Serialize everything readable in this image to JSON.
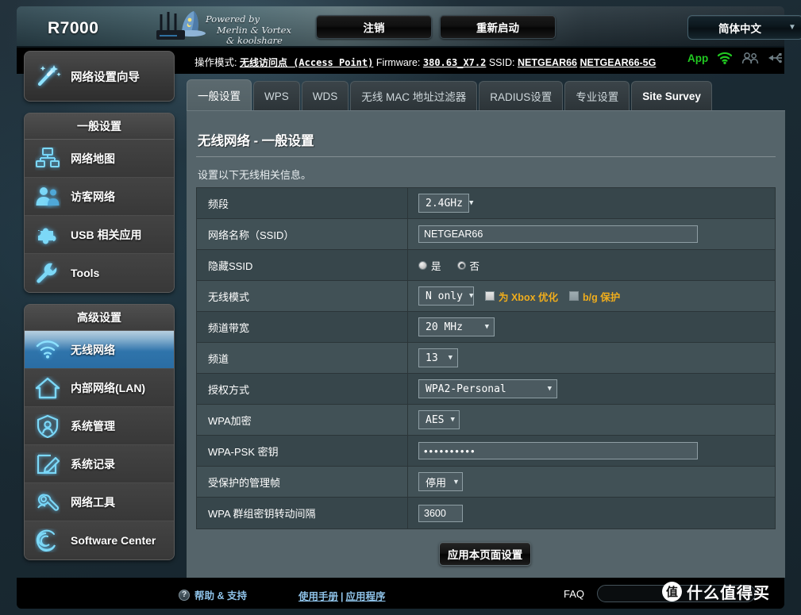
{
  "header": {
    "model": "R7000",
    "powered_line1": "Powered by",
    "powered_line2": "Merlin & Vortex",
    "powered_line3": "& koolshare",
    "logout_label": "注销",
    "reboot_label": "重新启动",
    "language": "简体中文",
    "language_arrow": "▼"
  },
  "status": {
    "mode_label": "操作模式:",
    "mode_value": "无线访问点 (Access Point)",
    "firmware_label": "Firmware:",
    "firmware_value": "380.63_X7.2",
    "ssid_label": "SSID:",
    "ssid_1": "NETGEAR66",
    "ssid_2": "NETGEAR66-5G",
    "app_label": "App",
    "icons": [
      "wifi-icon",
      "users-icon",
      "usb-icon"
    ]
  },
  "sidebar": {
    "wizard": {
      "label": "网络设置向导",
      "icon": "magic-wand-icon"
    },
    "group_general": {
      "title": "一般设置",
      "items": [
        {
          "label": "网络地图",
          "icon": "network-map-icon"
        },
        {
          "label": "访客网络",
          "icon": "guest-users-icon"
        },
        {
          "label": "USB 相关应用",
          "icon": "puzzle-icon"
        },
        {
          "label": "Tools",
          "icon": "wrench-icon"
        }
      ]
    },
    "group_advanced": {
      "title": "高级设置",
      "items": [
        {
          "label": "无线网络",
          "icon": "wifi-icon",
          "active": true
        },
        {
          "label": "内部网络(LAN)",
          "icon": "home-icon",
          "active": false
        },
        {
          "label": "系统管理",
          "icon": "user-admin-icon",
          "active": false
        },
        {
          "label": "系统记录",
          "icon": "edit-note-icon",
          "active": false
        },
        {
          "label": "网络工具",
          "icon": "network-tools-icon",
          "active": false
        },
        {
          "label": "Software Center",
          "icon": "debian-swirl-icon",
          "active": false
        }
      ]
    }
  },
  "tabs": [
    {
      "label": "一般设置",
      "active": true
    },
    {
      "label": "WPS",
      "active": false
    },
    {
      "label": "WDS",
      "active": false
    },
    {
      "label": "无线 MAC 地址过滤器",
      "active": false
    },
    {
      "label": "RADIUS设置",
      "active": false
    },
    {
      "label": "专业设置",
      "active": false
    },
    {
      "label": "Site Survey",
      "active": false
    }
  ],
  "panel": {
    "title": "无线网络 - 一般设置",
    "description": "设置以下无线相关信息。",
    "apply_label": "应用本页面设置"
  },
  "form": [
    {
      "label": "频段",
      "type": "select",
      "value": "2.4GHz"
    },
    {
      "label": "网络名称（SSID）",
      "type": "text",
      "value": "NETGEAR66"
    },
    {
      "label": "隐藏SSID",
      "type": "radio",
      "options": [
        {
          "label": "是",
          "selected": false
        },
        {
          "label": "否",
          "selected": true
        }
      ]
    },
    {
      "label": "无线模式",
      "type": "select-checkbox",
      "value": "N only",
      "checkboxes": [
        {
          "label": "为 Xbox 优化",
          "checked": false
        },
        {
          "label": "b/g 保护",
          "checked": false
        }
      ]
    },
    {
      "label": "频道带宽",
      "type": "select",
      "value": "20 MHz"
    },
    {
      "label": "频道",
      "type": "select",
      "value": "13"
    },
    {
      "label": "授权方式",
      "type": "select",
      "value": "WPA2-Personal"
    },
    {
      "label": "WPA加密",
      "type": "select",
      "value": "AES"
    },
    {
      "label": "WPA-PSK 密钥",
      "type": "password",
      "value": "••••••••••"
    },
    {
      "label": "受保护的管理帧",
      "type": "select",
      "value": "停用"
    },
    {
      "label": "WPA 群组密钥转动间隔",
      "type": "text",
      "value": "3600"
    }
  ],
  "footer": {
    "help_label": "帮助 & 支持",
    "help_icon": "question-icon",
    "manual_link": "使用手册",
    "link_separator": "|",
    "apps_link": "应用程序",
    "faq_label": "FAQ",
    "search_placeholder": ""
  },
  "watermark": {
    "badge": "值",
    "text": "什么值得买"
  },
  "colors": {
    "accent_blue": "#2f74ab",
    "link_blue": "#8ec2e8",
    "checkbox_label": "#f0ad1c",
    "panel_bg": "#55646a",
    "row_odd": "#37464b",
    "row_even": "#415156",
    "app_green": "#21c921"
  }
}
